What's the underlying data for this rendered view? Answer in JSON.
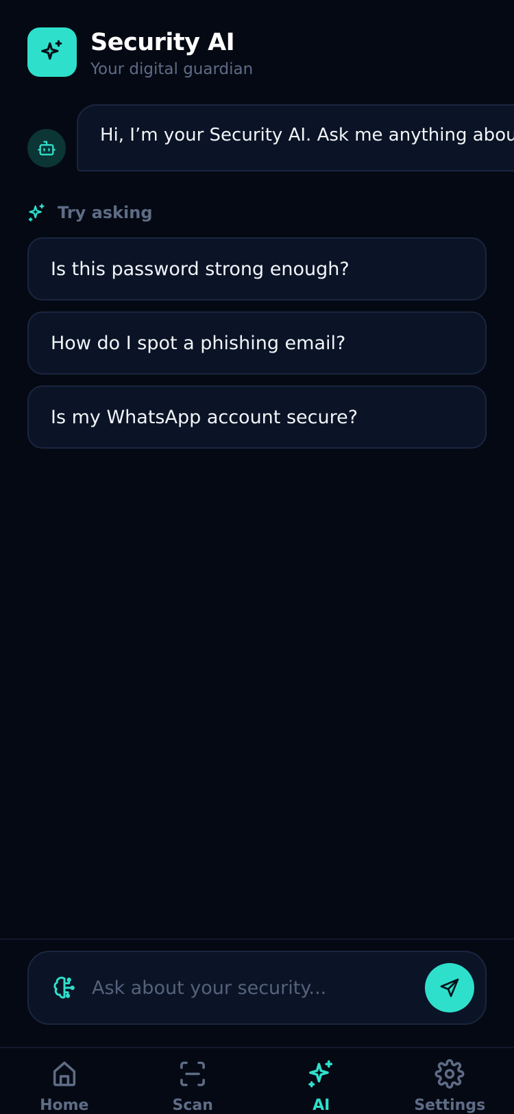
{
  "header": {
    "title": "Security AI",
    "subtitle": "Your digital guardian",
    "logo_icon": "sparkles-icon"
  },
  "chat": {
    "messages": [
      {
        "sender": "bot",
        "avatar_icon": "bot-icon",
        "text": "Hi, I’m your Security AI. Ask me anything about"
      }
    ]
  },
  "suggestions": {
    "label": "Try asking",
    "items": [
      "Is this password strong enough?",
      "How do I spot a phishing email?",
      "Is my WhatsApp account secure?"
    ]
  },
  "input": {
    "placeholder": "Ask about your security...",
    "value": "",
    "left_icon": "brain-icon",
    "send_icon": "send-icon"
  },
  "nav": {
    "items": [
      {
        "label": "Home",
        "icon": "home-icon",
        "active": false
      },
      {
        "label": "Scan",
        "icon": "scan-icon",
        "active": false
      },
      {
        "label": "AI",
        "icon": "sparkles-icon",
        "active": true
      },
      {
        "label": "Settings",
        "icon": "gear-icon",
        "active": false
      }
    ]
  },
  "colors": {
    "background": "#050913",
    "accent": "#2ee0cc",
    "card": "#0b1426",
    "muted": "#5e6c86"
  }
}
